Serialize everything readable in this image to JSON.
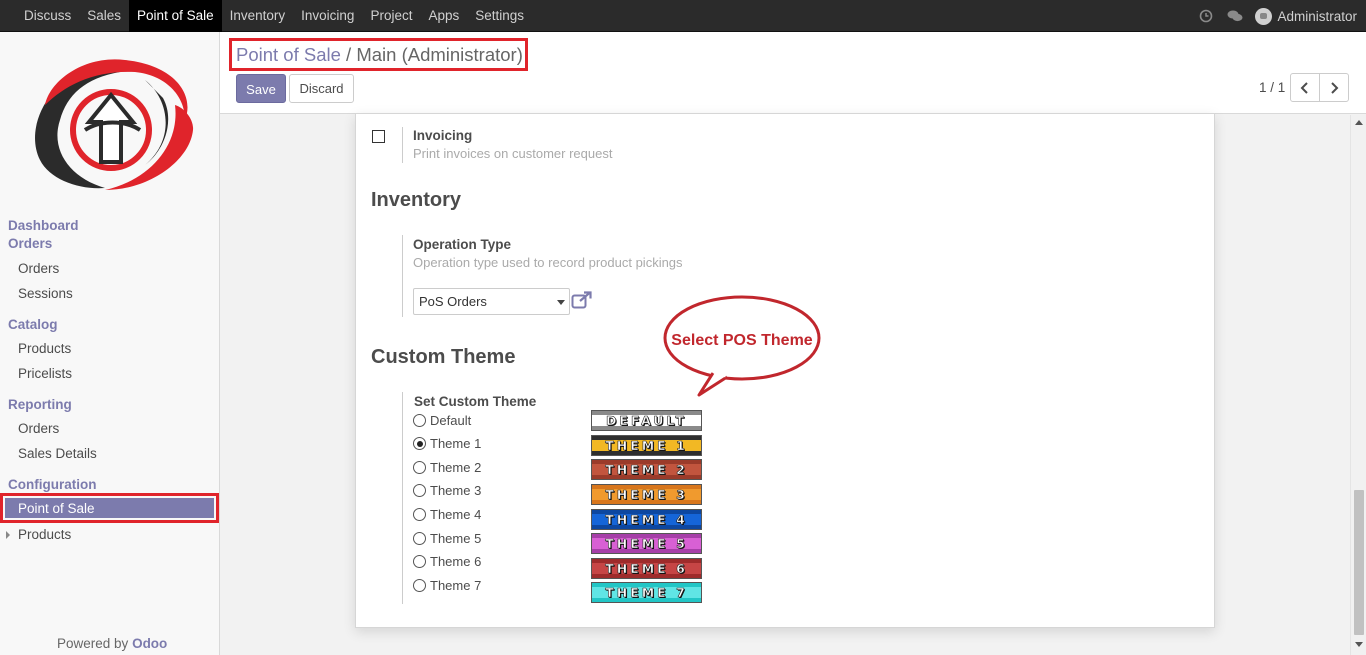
{
  "topbar": {
    "menu": [
      "Discuss",
      "Sales",
      "Point of Sale",
      "Inventory",
      "Invoicing",
      "Project",
      "Apps",
      "Settings"
    ],
    "active": "Point of Sale",
    "user": "Administrator"
  },
  "sidebar": {
    "groups": [
      {
        "title": "Dashboard"
      },
      {
        "title": "Orders",
        "items": [
          "Orders",
          "Sessions"
        ]
      },
      {
        "title": "Catalog",
        "items": [
          "Products",
          "Pricelists"
        ]
      },
      {
        "title": "Reporting",
        "items": [
          "Orders",
          "Sales Details"
        ]
      },
      {
        "title": "Configuration",
        "items": [
          "Point of Sale",
          "Products"
        ]
      }
    ],
    "active_item": "Point of Sale",
    "powered_by": "Powered by",
    "powered_brand": "Odoo"
  },
  "control": {
    "breadcrumb_link": "Point of Sale",
    "breadcrumb_sep": "/",
    "breadcrumb_current": "Main (Administrator)",
    "save": "Save",
    "discard": "Discard",
    "pager": "1 / 1"
  },
  "form": {
    "invoicing": {
      "label": "Invoicing",
      "help": "Print invoices on customer request",
      "checked": false
    },
    "inventory": {
      "heading": "Inventory",
      "operation_type_label": "Operation Type",
      "operation_type_help": "Operation type used to record product pickings",
      "operation_type_value": "PoS Orders"
    },
    "custom_theme": {
      "heading": "Custom Theme",
      "label": "Set Custom Theme",
      "options": [
        "Default",
        "Theme 1",
        "Theme 2",
        "Theme 3",
        "Theme 4",
        "Theme 5",
        "Theme 6",
        "Theme 7"
      ],
      "selected": "Theme 1",
      "badges": [
        "DEFAULT",
        "THEME 1",
        "THEME 2",
        "THEME 3",
        "THEME 4",
        "THEME 5",
        "THEME 6",
        "THEME 7"
      ],
      "badge_colors": [
        "#8a8a8a",
        "#2e2e2e",
        "#9b3b2a",
        "#d8761c",
        "#0d47a0",
        "#a63fa8",
        "#9e2b2b",
        "#22c6c6"
      ],
      "badge_bands": [
        "#ffffff",
        "#f2b824",
        "#c2553e",
        "#f09a2e",
        "#1565d8",
        "#d860d4",
        "#c64545",
        "#60e5e5"
      ]
    }
  },
  "annotation": {
    "callout": "Select POS Theme"
  },
  "colors": {
    "brand": "#7c7bad",
    "highlight": "#e0242b"
  }
}
